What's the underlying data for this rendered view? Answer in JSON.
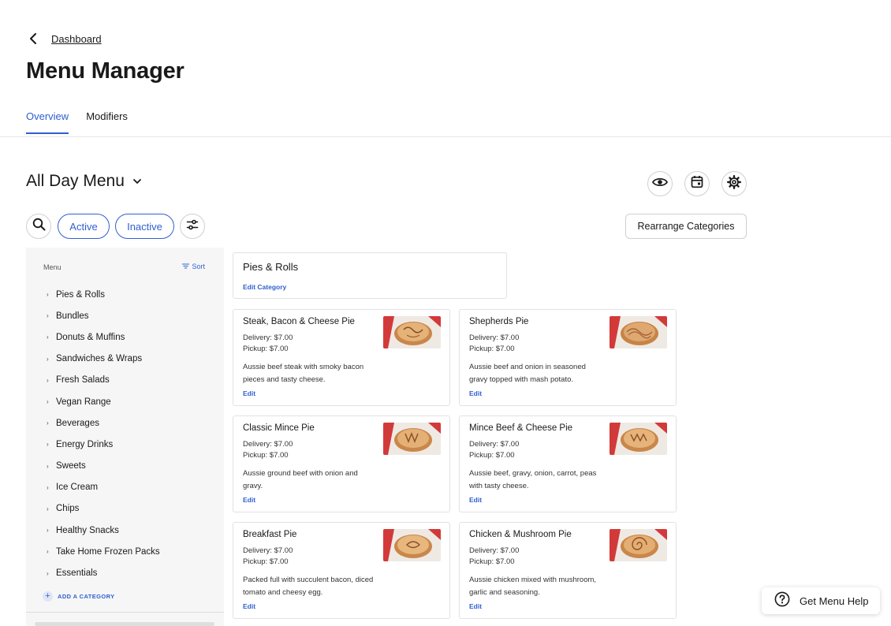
{
  "breadcrumb": {
    "label": "Dashboard"
  },
  "page": {
    "title": "Menu Manager"
  },
  "tabs": [
    {
      "label": "Overview",
      "active": true
    },
    {
      "label": "Modifiers",
      "active": false
    }
  ],
  "menu_selector": {
    "value": "All Day Menu"
  },
  "filters": {
    "active_label": "Active",
    "inactive_label": "Inactive"
  },
  "toolbar": {
    "rearrange_label": "Rearrange Categories"
  },
  "sidebar": {
    "header": "Menu",
    "sort_label": "Sort",
    "add_category_label": "ADD A CATEGORY",
    "categories": [
      "Pies & Rolls",
      "Bundles",
      "Donuts & Muffins",
      "Sandwiches & Wraps",
      "Fresh Salads",
      "Vegan Range",
      "Beverages",
      "Energy Drinks",
      "Sweets",
      "Ice Cream",
      "Chips",
      "Healthy Snacks",
      "Take Home Frozen Packs",
      "Essentials"
    ]
  },
  "category": {
    "title": "Pies & Rolls",
    "edit_label": "Edit Category"
  },
  "items": [
    {
      "name": "Steak, Bacon & Cheese Pie",
      "delivery": "Delivery: $7.00",
      "pickup": "Pickup: $7.00",
      "description": "Aussie beef steak with smoky bacon pieces and tasty cheese.",
      "edit_label": "Edit"
    },
    {
      "name": "Shepherds Pie",
      "delivery": "Delivery: $7.00",
      "pickup": "Pickup: $7.00",
      "description": "Aussie beef and onion in seasoned gravy topped with mash potato.",
      "edit_label": "Edit"
    },
    {
      "name": "Classic Mince Pie",
      "delivery": "Delivery: $7.00",
      "pickup": "Pickup: $7.00",
      "description": "Aussie ground beef with onion and gravy.",
      "edit_label": "Edit"
    },
    {
      "name": "Mince Beef & Cheese Pie",
      "delivery": "Delivery: $7.00",
      "pickup": "Pickup: $7.00",
      "description": "Aussie beef, gravy, onion, carrot, peas with tasty cheese.",
      "edit_label": "Edit"
    },
    {
      "name": "Breakfast Pie",
      "delivery": "Delivery: $7.00",
      "pickup": "Pickup: $7.00",
      "description": "Packed full with succulent bacon, diced tomato and cheesy egg.",
      "edit_label": "Edit"
    },
    {
      "name": "Chicken & Mushroom Pie",
      "delivery": "Delivery: $7.00",
      "pickup": "Pickup: $7.00",
      "description": "Aussie chicken mixed with mushroom, garlic and seasoning.",
      "edit_label": "Edit"
    }
  ],
  "help": {
    "label": "Get Menu Help"
  },
  "colors": {
    "accent": "#2f5fd0",
    "sidebar_bg": "#f6f6f6",
    "text": "#191919"
  },
  "icons": {
    "back": "chevron-left-icon",
    "menu_dropdown": "chevron-down-icon",
    "preview": "eye-icon",
    "schedule": "calendar-icon",
    "settings": "gear-icon",
    "search": "search-icon",
    "filter": "sliders-icon",
    "sort": "sort-lines-icon",
    "add": "plus-icon",
    "help": "question-circle-icon"
  }
}
